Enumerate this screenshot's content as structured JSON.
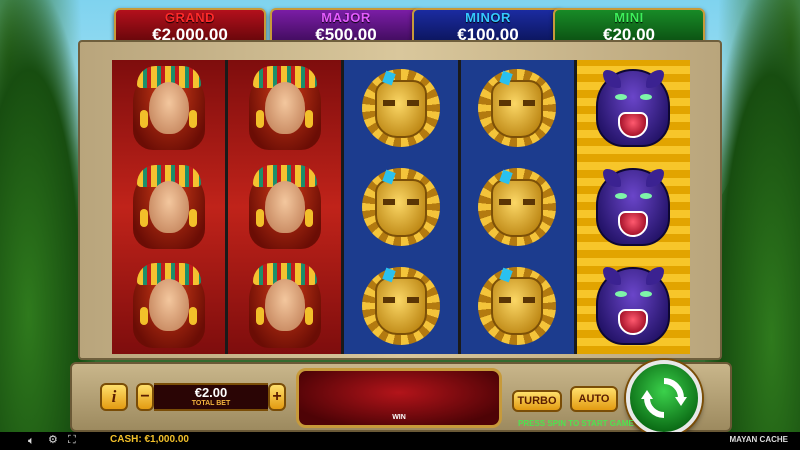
{
  "jackpots": [
    {
      "label": "GRAND",
      "value": "€2,000.00",
      "label_color": "#ff2a2a"
    },
    {
      "label": "MAJOR",
      "value": "€500.00",
      "label_color": "#e45bff"
    },
    {
      "label": "MINOR",
      "value": "€100.00",
      "label_color": "#35c8ff"
    },
    {
      "label": "MINI",
      "value": "€20.00",
      "label_color": "#3df05a"
    }
  ],
  "reels": [
    {
      "background": "red",
      "symbols": [
        "princess",
        "princess",
        "princess"
      ]
    },
    {
      "background": "red",
      "symbols": [
        "princess",
        "princess",
        "princess"
      ]
    },
    {
      "background": "blue",
      "symbols": [
        "gold-mask",
        "gold-mask",
        "gold-mask"
      ]
    },
    {
      "background": "blue",
      "symbols": [
        "gold-mask",
        "gold-mask",
        "gold-mask"
      ]
    },
    {
      "background": "gold",
      "symbols": [
        "purple-panther",
        "purple-panther",
        "purple-panther"
      ]
    }
  ],
  "controls": {
    "info_label": "i",
    "minus_label": "−",
    "plus_label": "+",
    "bet_value": "€2.00",
    "bet_label": "TOTAL BET",
    "win_label": "WIN",
    "turbo_label": "TURBO",
    "auto_label": "AUTO",
    "spin_icon": "spin-arrows-icon",
    "spin_hint": "PRESS SPIN TO START GAME"
  },
  "status_bar": {
    "cash_label": "CASH:",
    "cash_value": "€1,000.00",
    "game_name": "MAYAN CACHE",
    "icons": [
      "sound-icon",
      "settings-icon",
      "fullscreen-icon"
    ]
  },
  "colors": {
    "accent_gold": "#f2c02a",
    "spin_green": "#2bbf3c",
    "hint_green": "#4fe24f"
  }
}
